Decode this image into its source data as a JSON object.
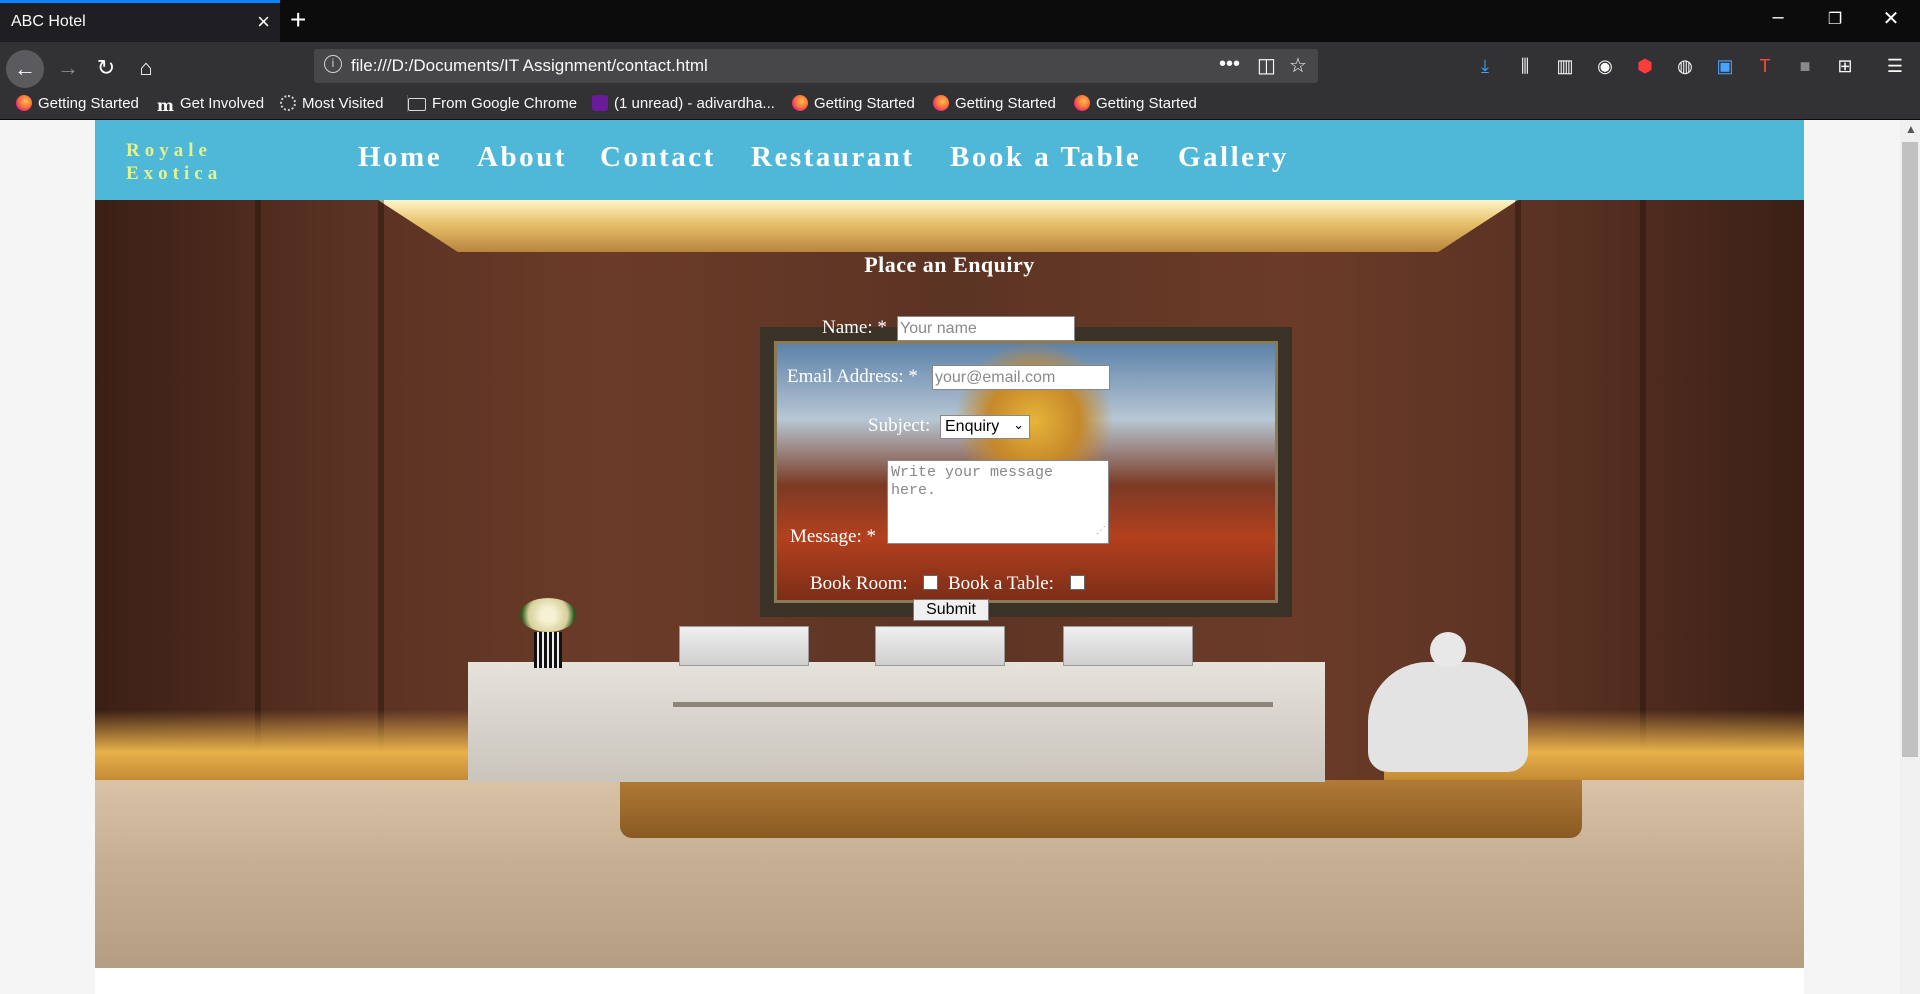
{
  "browser": {
    "tab_title": "ABC Hotel",
    "url": "file:///D:/Documents/IT Assignment/contact.html",
    "bookmarks": [
      "Getting Started",
      "Get Involved",
      "Most Visited",
      "From Google Chrome",
      "(1 unread) - adivardha...",
      "Getting Started",
      "Getting Started",
      "Getting Started"
    ]
  },
  "site": {
    "logo_line1": "Royale",
    "logo_line2": "Exotica",
    "nav": [
      "Home",
      "About",
      "Contact",
      "Restaurant",
      "Book a Table",
      "Gallery"
    ],
    "header_color": "#4fb7d7",
    "logo_color": "#e3f58a"
  },
  "form": {
    "title": "Place an Enquiry",
    "name_label": "Name: *",
    "name_placeholder": "Your name",
    "email_label": "Email Address: *",
    "email_placeholder": "your@email.com",
    "subject_label": "Subject:",
    "subject_value": "Enquiry",
    "message_label": "Message: *",
    "message_placeholder": "Write your message here.",
    "book_room_label": "Book Room:",
    "book_table_label": "Book a Table:",
    "submit_label": "Submit"
  }
}
